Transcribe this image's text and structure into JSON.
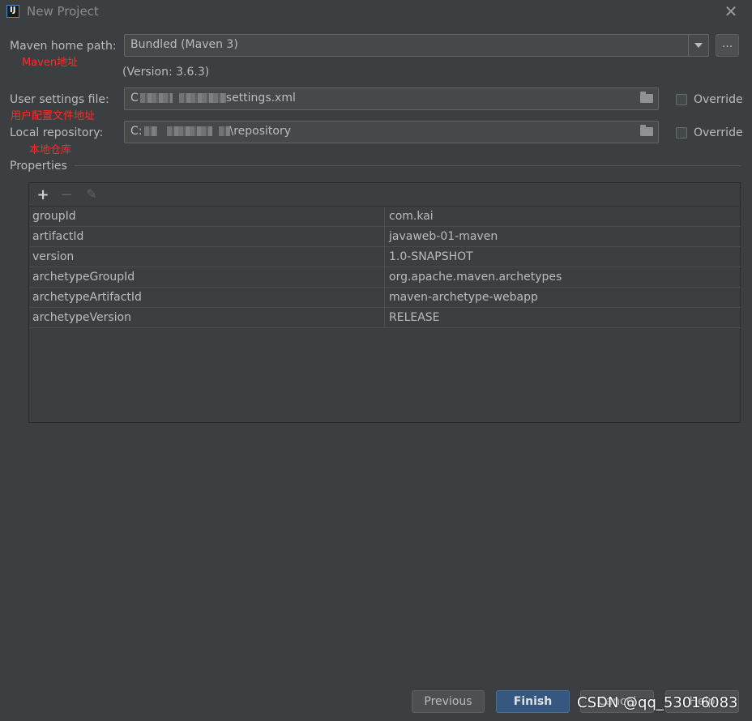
{
  "window": {
    "title": "New Project",
    "close_glyph": "✕"
  },
  "maven_home": {
    "label": "Maven home path:",
    "annotation": "Maven地址",
    "selected": "Bundled (Maven 3)",
    "version": "(Version: 3.6.3)",
    "browse_label": "..."
  },
  "user_settings": {
    "label": "User settings file:",
    "annotation": "用户配置文件地址",
    "value_prefix": "C",
    "value_suffix": "settings.xml",
    "override_label": "Override"
  },
  "local_repository": {
    "label": "Local repository:",
    "annotation": "本地仓库",
    "value_prefix": "C:",
    "value_suffix": "\\repository",
    "override_label": "Override"
  },
  "properties": {
    "label": "Properties",
    "toolbar": {
      "add": "+",
      "remove": "−",
      "edit": "✎"
    },
    "rows": [
      {
        "key": "groupId",
        "value": "com.kai"
      },
      {
        "key": "artifactId",
        "value": "javaweb-01-maven"
      },
      {
        "key": "version",
        "value": "1.0-SNAPSHOT"
      },
      {
        "key": "archetypeGroupId",
        "value": "org.apache.maven.archetypes"
      },
      {
        "key": "archetypeArtifactId",
        "value": "maven-archetype-webapp"
      },
      {
        "key": "archetypeVersion",
        "value": "RELEASE"
      }
    ]
  },
  "buttons": {
    "previous": "Previous",
    "finish": "Finish",
    "cancel": "Cancel",
    "help": "Help"
  },
  "watermark": "CSDN @qq_53016083",
  "colors": {
    "background": "#3c3f41",
    "accent": "#365880",
    "annotation": "#ff2a2a"
  }
}
